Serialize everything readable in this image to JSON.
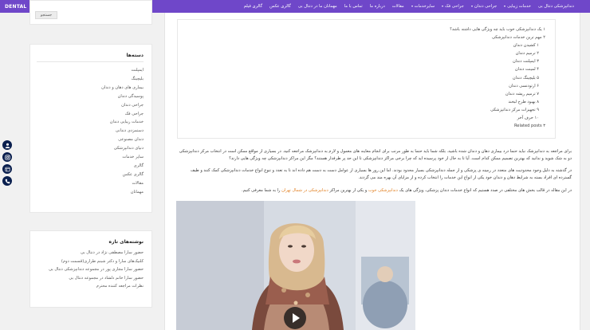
{
  "nav": {
    "brand": "DENTAL",
    "items": [
      {
        "label": "دندانپزشکی دنتال بی",
        "caret": false
      },
      {
        "label": "خدمات زیبایی",
        "caret": true
      },
      {
        "label": "جراحی دندان",
        "caret": true
      },
      {
        "label": "جراحی فک",
        "caret": true
      },
      {
        "label": "سایرخدمات",
        "caret": true
      },
      {
        "label": "مقالات",
        "caret": false
      },
      {
        "label": "درباره ما",
        "caret": false
      },
      {
        "label": "تماس با ما",
        "caret": false
      },
      {
        "label": "مهمانان ما در دنتال بی",
        "caret": false
      },
      {
        "label": "گالری عکس",
        "caret": false
      },
      {
        "label": "گالری فیلم",
        "caret": false
      }
    ]
  },
  "toc": [
    {
      "text": "۱ یک دندانپزشکی خوب باید چه ویژگی هایی داشته باشد؟",
      "sub": false
    },
    {
      "text": "۲ مهم ترین خدمات دندانپزشکی",
      "sub": false
    },
    {
      "text": "۱ کشیدن دندان",
      "sub": true
    },
    {
      "text": "۲ ترمیم دندان",
      "sub": true
    },
    {
      "text": "۳ ایمپلنت دندان",
      "sub": true
    },
    {
      "text": "۴ لمینت دندان",
      "sub": true
    },
    {
      "text": "۵ بلیچینگ دندان",
      "sub": true
    },
    {
      "text": "۶ ارتودنسی دندان",
      "sub": true
    },
    {
      "text": "۷ ترمیم ریشه دندان",
      "sub": true
    },
    {
      "text": "۸ بهبود طرح لبخند",
      "sub": true
    },
    {
      "text": "۹ تجهیزات مرکز دندانپزشکی",
      "sub": true
    },
    {
      "text": "۱۰ حرف آخر",
      "sub": true
    },
    {
      "text": "۳ Related posts",
      "sub": false
    }
  ],
  "article": {
    "p1": "برای مراجعه به دندانپزشک نباید حتما درد بیماری دهان و دندان شده باشید. بلکه شما باید حتما به طور مرتب برای انجام معاینه های معمول و لازم به دندانپزشک مراجعه کنید. در بسیاری از مواقع ممکن است در انتخاب مرکز دندانپزشکی دو به شک شوید و ندانید که بهترین تصمیم ممکن کدام است. آیا تا به حال از خود پرسیده اید که چرا برخی مراکز دندانپزشکی تا این حد پر طرفدار هستند؟ مگر این مراکز دندانپزشکی چه ویژگی هایی دارند؟",
    "p2": "در گذشته به دلیل وجود محدودیت های متعدد در زمینه ی پزشکی و از جمله دندانپزشکی بسیار محدود بودند. اما این روز ها بسیاری از عوامل دست به دست هم داده اند تا به تعدد و تنوع انواع خدمات دندانپزشکی کمک کنند و طیف گسترده ای افراد بسته به شرایط دهان و دندان خود یکی از انواع این خدمات را انتخاب کرده و از مزایای آن بهره مند می گردند.",
    "p3_before": "در این مقاله در قالب بخش های مختلفی در صدد هستیم که انواع خدمات دندان پزشکی، ویژگی های یک ",
    "p3_link1": "دندانپزشکی خوب",
    "p3_middle": " و یکی از بهترین مراکز ",
    "p3_link2": "دندانپزشکی در شمال تهران",
    "p3_after": " را به شما معرفی کنیم."
  },
  "sidebar": {
    "search_button": "جستجو",
    "categories_title": "دسته‌ها",
    "categories": [
      "ایمپلنت",
      "بلیچینگ",
      "بیماری های دهان و دندان",
      "پوسیدگی دندان",
      "جراحی دندان",
      "جراحی فک",
      "خدمات زیبایی دندان",
      "دستمزدی دندانی",
      "دندان مصنوعی",
      "دنیای دندانپزشکی",
      "سایر خدمات",
      "گالری",
      "گالری عکس",
      "مقالات",
      "مهمانان"
    ],
    "recent_title": "نوشته‌های تازه",
    "recent": [
      "حضور سارا مصطفی نژاد در دنتال بی",
      "کلنیک‌های سارا و دکتر شبنم طراری(قسمت دوم)",
      "حضور سارا مجازی پور در مجموعه دندانپزشکی دنتال بی",
      "حضور سارا خانم دلشاد در مجموعه دنتال بی",
      "نظرات مراجعه کننده محترم"
    ]
  },
  "social": [
    "user-icon",
    "instagram-icon",
    "telegram-icon",
    "phone-icon"
  ],
  "colors": {
    "nav": "#6f47c9",
    "link": "#e07a18",
    "social": "#0a1f4e"
  }
}
